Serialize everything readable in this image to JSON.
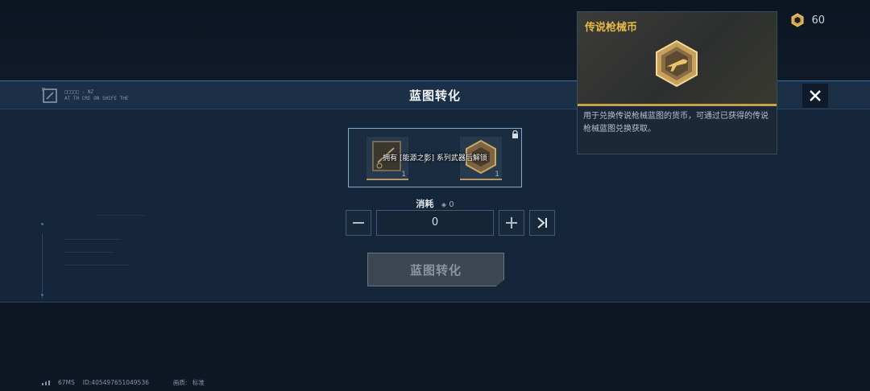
{
  "header": {
    "currency_value": "60"
  },
  "modal": {
    "title": "蓝图转化",
    "corner_text_line1": "□□□□□ - NZ",
    "corner_text_line2": "AT TH CRE ON SHIFE THE",
    "convert": {
      "left_count": "1",
      "right_count": "1",
      "lock_message": "拥有 [能源之影] 系列武器后解锁"
    },
    "cost": {
      "label": "消耗",
      "value": "0"
    },
    "quantity": {
      "value": "0"
    },
    "convert_button": "蓝图转化"
  },
  "tooltip": {
    "title": "传说枪械币",
    "description": "用于兑换传说枪械蓝图的货币，可通过已获得的传说枪械蓝图兑换获取。"
  },
  "footer": {
    "latency": "67MS",
    "id": "ID:405497651049536",
    "quality_label": "画质:",
    "quality_value": "标准"
  },
  "colors": {
    "accent_gold": "#c8a24a",
    "title_gold": "#e9b94a",
    "border_blue": "#7fa8c9"
  }
}
